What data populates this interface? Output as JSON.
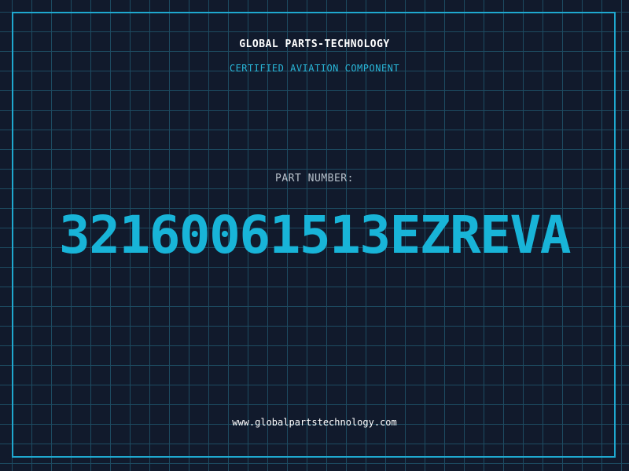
{
  "header": {
    "company": "GLOBAL PARTS-TECHNOLOGY",
    "subtitle": "CERTIFIED AVIATION COMPONENT"
  },
  "part": {
    "label": "PART NUMBER:",
    "number": "32160061513EZREVA"
  },
  "footer": {
    "website": "www.globalpartstechnology.com"
  },
  "colors": {
    "background": "#111a2c",
    "grid": "#1d4b61",
    "accent": "#18b4d8",
    "frame": "#1fa8cf"
  }
}
